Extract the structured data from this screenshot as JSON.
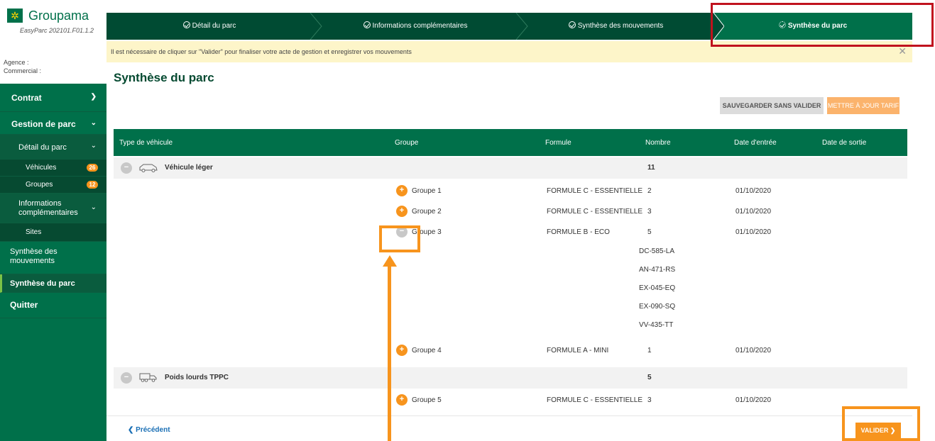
{
  "app": {
    "logo_name": "Groupama",
    "version": "EasyParc 202101.F01.1.2"
  },
  "agency": {
    "agence_label": "Agence :",
    "commercial_label": "Commercial :"
  },
  "sidebar": {
    "contrat": "Contrat",
    "gestion": "Gestion de parc",
    "detail": "Détail du parc",
    "vehicules": {
      "label": "Véhicules",
      "count": "26"
    },
    "groupes": {
      "label": "Groupes",
      "count": "12"
    },
    "infos_line1": "Informations",
    "infos_line2": "complémentaires",
    "sites": "Sites",
    "synth_mvt_line1": "Synthèse des",
    "synth_mvt_line2": "mouvements",
    "synth_parc": "Synthèse du parc",
    "quitter": "Quitter"
  },
  "steps": [
    "Détail du parc",
    "Informations complémentaires",
    "Synthèse des mouvements",
    "Synthèse du parc"
  ],
  "alert": {
    "text": "Il est nécessaire de cliquer sur \"Valider\" pour finaliser votre acte de gestion et enregistrer vos mouvements",
    "close": "✕"
  },
  "page_title": "Synthèse du parc",
  "buttons": {
    "save": "SAUVEGARDER SANS VALIDER",
    "tarif": "METTRE À JOUR TARIF",
    "valider": "VALIDER",
    "precedent": "Précédent"
  },
  "table": {
    "headers": [
      "Type de véhicule",
      "Groupe",
      "Formule",
      "Nombre",
      "Date d'entrée",
      "Date de sortie"
    ],
    "vehicle_types": [
      {
        "label": "Véhicule léger",
        "count": "11"
      },
      {
        "label": "Poids lourds TPPC",
        "count": "5"
      }
    ],
    "groups": [
      {
        "name": "Groupe 1",
        "formule": "FORMULE C - ESSENTIELLE",
        "nombre": "2",
        "date": "01/10/2020"
      },
      {
        "name": "Groupe 2",
        "formule": "FORMULE C - ESSENTIELLE",
        "nombre": "3",
        "date": "01/10/2020"
      },
      {
        "name": "Groupe 3",
        "formule": "FORMULE B - ECO",
        "nombre": "5",
        "date": "01/10/2020"
      },
      {
        "name": "Groupe 4",
        "formule": "FORMULE A - MINI",
        "nombre": "1",
        "date": "01/10/2020"
      },
      {
        "name": "Groupe 5",
        "formule": "FORMULE C - ESSENTIELLE",
        "nombre": "3",
        "date": "01/10/2020"
      }
    ],
    "plates": [
      "DC-585-LA",
      "AN-471-RS",
      "EX-045-EQ",
      "EX-090-SQ",
      "VV-435-TT"
    ]
  },
  "colors": {
    "brand_green": "#00704a",
    "dark_green": "#004b33",
    "accent_orange": "#f7941d",
    "highlight_red": "#c0121e"
  }
}
